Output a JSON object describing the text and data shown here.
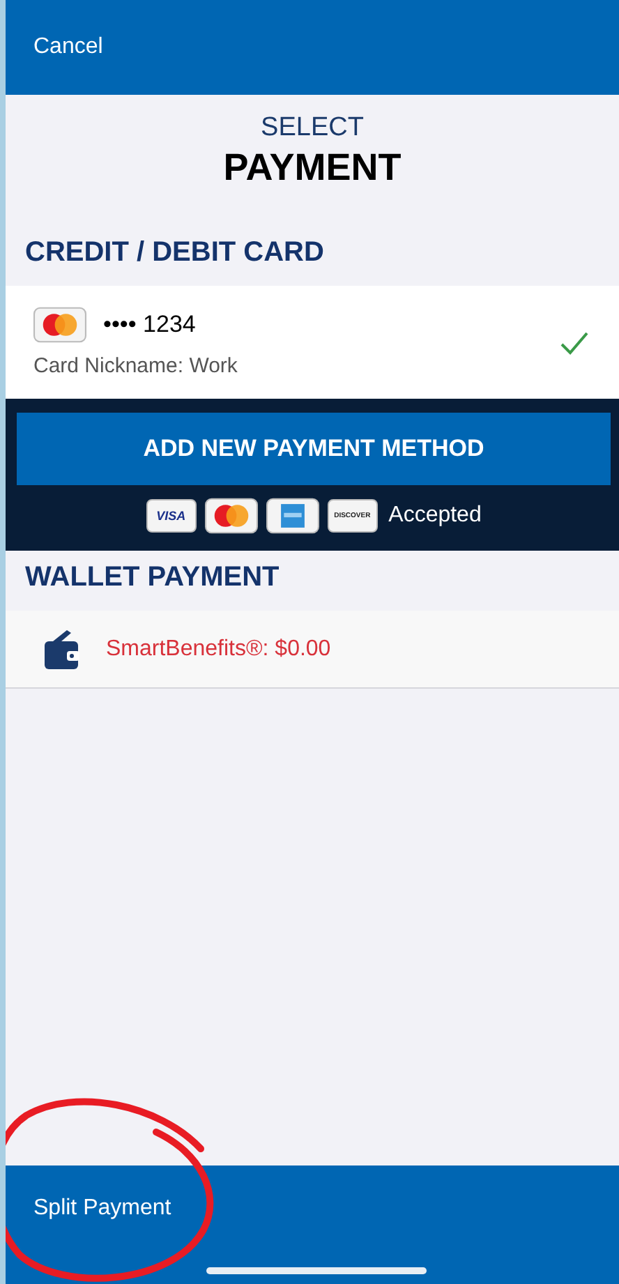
{
  "top_bar": {
    "cancel": "Cancel"
  },
  "title": {
    "line_1": "SELECT",
    "line_2": "PAYMENT"
  },
  "card_section": {
    "heading": "CREDIT / DEBIT CARD",
    "cards": [
      {
        "kind": "mastercard",
        "number": "•••• 1234",
        "nickname": "Card Nickname: Work",
        "selected": true
      }
    ],
    "add_button": "ADD NEW PAYMENT METHOD",
    "accepted_cards": [
      {
        "kind": "visa",
        "label": "VISA"
      },
      {
        "kind": "mastercard"
      },
      {
        "kind": "amex"
      },
      {
        "kind": "discover",
        "label": "DISCOVER"
      }
    ],
    "accepted_label": "Accepted"
  },
  "wallet_section": {
    "heading": "WALLET PAYMENT",
    "items": [
      {
        "label": "SmartBenefits®: $0.00"
      }
    ]
  },
  "bottom_bar": {
    "split": "Split Payment"
  },
  "annotation": {
    "kind": "circle"
  }
}
